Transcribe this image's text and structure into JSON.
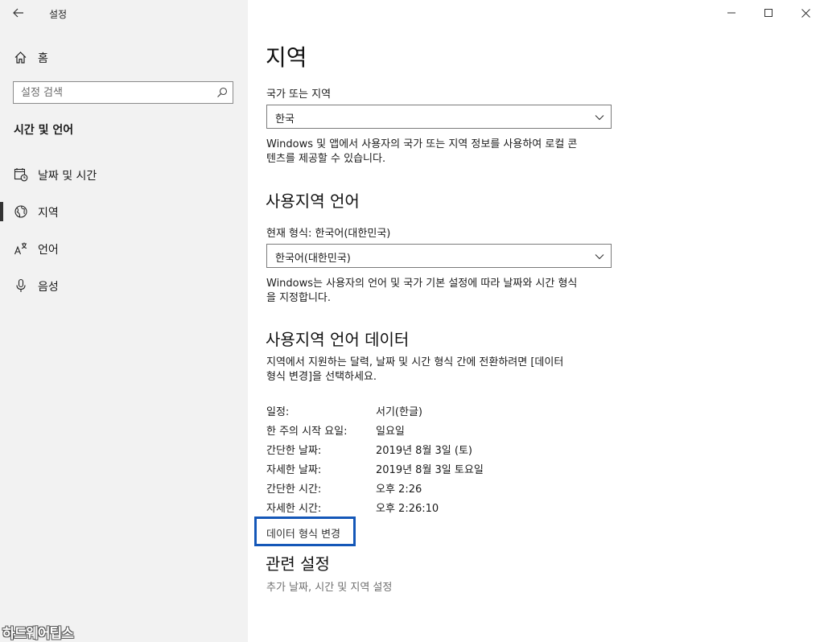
{
  "window": {
    "app_title": "설정",
    "minimize_icon": "minimize-icon",
    "maximize_icon": "maximize-icon",
    "close_icon": "close-icon"
  },
  "sidebar": {
    "home_label": "홈",
    "search_placeholder": "설정 검색",
    "section_title": "시간 및 언어",
    "items": [
      {
        "label": "날짜 및 시간",
        "icon": "calendar-clock-icon",
        "selected": false
      },
      {
        "label": "지역",
        "icon": "globe-icon",
        "selected": true
      },
      {
        "label": "언어",
        "icon": "language-icon",
        "selected": false
      },
      {
        "label": "음성",
        "icon": "microphone-icon",
        "selected": false
      }
    ],
    "selected_marker_color": "#333333"
  },
  "watermark": "하드웨어팁스",
  "main": {
    "page_title": "지역",
    "country": {
      "label": "국가 또는 지역",
      "value": "한국",
      "desc_line1": "Windows 및 앱에서 사용자의 국가 또는 지역 정보를 사용하여 로컬 콘",
      "desc_line2": "텐츠를 제공할 수 있습니다."
    },
    "regional_format": {
      "heading": "사용지역 언어",
      "current_label": "현재 형식: 한국어(대한민국)",
      "value": "한국어(대한민국)",
      "desc_line1": "Windows는 사용자의 언어 및 국가 기본 설정에 따라 날짜와 시간 형식",
      "desc_line2": "을 지정합니다."
    },
    "format_data": {
      "heading": "사용지역 언어 데이터",
      "desc_line1": "지역에서 지원하는 달력, 날짜 및 시간 형식 간에 전환하려면 [데이터",
      "desc_line2": "형식 변경]을 선택하세요.",
      "rows": [
        {
          "key": "일정:",
          "value": "서기(한글)"
        },
        {
          "key": "한 주의 시작 요일:",
          "value": "일요일"
        },
        {
          "key": "간단한 날짜:",
          "value": "2019년 8월 3일 (토)"
        },
        {
          "key": "자세한 날짜:",
          "value": "2019년 8월 3일 토요일"
        },
        {
          "key": "간단한 시간:",
          "value": "오후 2:26"
        },
        {
          "key": "자세한 시간:",
          "value": "오후 2:26:10"
        }
      ],
      "change_link": "데이터 형식 변경",
      "highlight_color": "#1457b8"
    },
    "related": {
      "heading": "관련 설정",
      "link": "추가 날짜, 시간 및 지역 설정"
    }
  }
}
